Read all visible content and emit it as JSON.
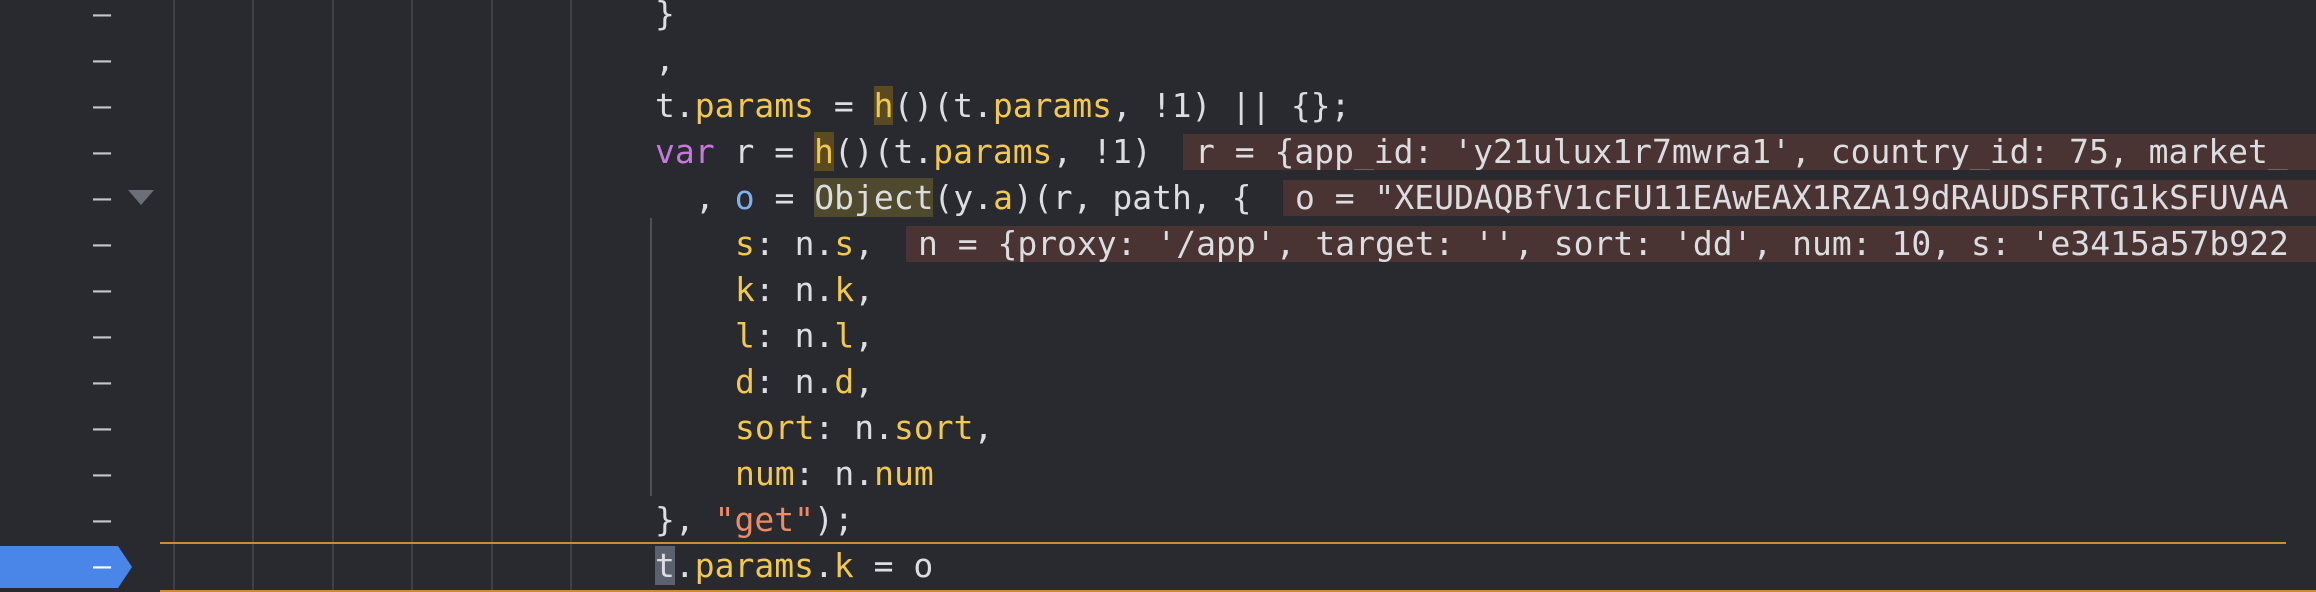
{
  "editor": {
    "current_line_index": 12,
    "lines": [
      {
        "text": "}"
      },
      {
        "text": ","
      },
      {
        "text": "t.params = h()(t.params, !1) || {};"
      },
      {
        "text": "var r = h()(t.params, !1)"
      },
      {
        "text": ", o = Object(y.a)(r, path, {"
      },
      {
        "text": "s: n.s,"
      },
      {
        "text": "k: n.k,"
      },
      {
        "text": "l: n.l,"
      },
      {
        "text": "d: n.d,"
      },
      {
        "text": "sort: n.sort,"
      },
      {
        "text": "num: n.num"
      },
      {
        "text": "}, \"get\");"
      },
      {
        "text": "t.params.k = o"
      }
    ],
    "inline_values": {
      "r": "r = {app_id: 'y21ulux1r7mwra1', country_id: 75, market_",
      "o": "o = \"XEUDAQBfV1cFU11EAwEAX1RZA19dRAUDSFRTG1kSFUVAA",
      "n": "n = {proxy: '/app', target: '', sort: 'dd', num: 10, s: 'e3415a57b922"
    },
    "gutter_marker": "–",
    "colors": {
      "background": "#282a30",
      "keyword": "#c678dd",
      "property": "#f3c84e",
      "string": "#f08a64",
      "text": "#dcdde0",
      "breakpoint": "#4a86e8",
      "current_line_border": "#c8902a",
      "inline_value_bg": "#4a3433"
    },
    "icons": {
      "fold": "fold-triangle-icon",
      "breakpoint": "breakpoint-marker-icon"
    }
  }
}
